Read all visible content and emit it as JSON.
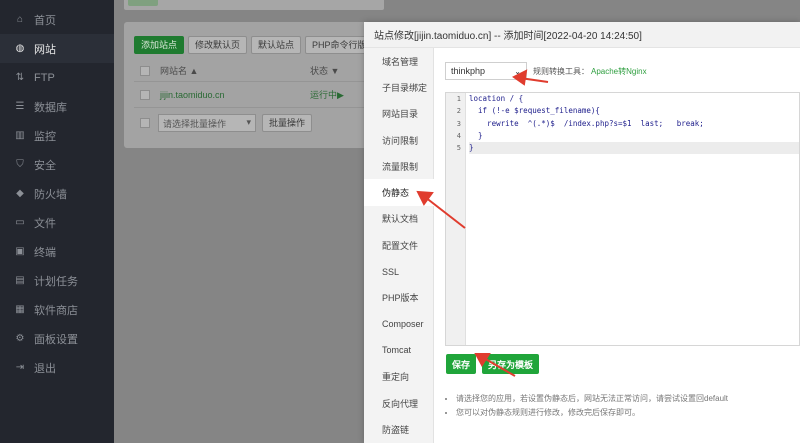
{
  "sidebar": {
    "items": [
      {
        "label": "首页",
        "icon": "home-icon",
        "glyph": "⌂",
        "active": false
      },
      {
        "label": "网站",
        "icon": "globe-icon",
        "glyph": "◍",
        "active": true
      },
      {
        "label": "FTP",
        "icon": "ftp-icon",
        "glyph": "⇅",
        "active": false
      },
      {
        "label": "数据库",
        "icon": "database-icon",
        "glyph": "☰",
        "active": false
      },
      {
        "label": "监控",
        "icon": "monitor-icon",
        "glyph": "▥",
        "active": false
      },
      {
        "label": "安全",
        "icon": "shield-icon",
        "glyph": "⛉",
        "active": false
      },
      {
        "label": "防火墙",
        "icon": "firewall-icon",
        "glyph": "◆",
        "active": false
      },
      {
        "label": "文件",
        "icon": "folder-icon",
        "glyph": "▭",
        "active": false
      },
      {
        "label": "终端",
        "icon": "terminal-icon",
        "glyph": "▣",
        "active": false
      },
      {
        "label": "计划任务",
        "icon": "calendar-icon",
        "glyph": "▤",
        "active": false
      },
      {
        "label": "软件商店",
        "icon": "apps-icon",
        "glyph": "▦",
        "active": false
      },
      {
        "label": "面板设置",
        "icon": "gear-icon",
        "glyph": "⚙",
        "active": false
      },
      {
        "label": "退出",
        "icon": "logout-icon",
        "glyph": "⇥",
        "active": false
      }
    ]
  },
  "main": {
    "buttons": [
      "添加站点",
      "修改默认页",
      "默认站点",
      "PHP命令行版本"
    ],
    "table": {
      "headers": {
        "name": "网站名 ▲",
        "status": "状态 ▼"
      },
      "rows": [
        {
          "name": "jijin.taomiduo.cn",
          "status": "运行中▶"
        }
      ]
    },
    "bulk": {
      "placeholder": "请选择批量操作",
      "button": "批量操作"
    }
  },
  "modal": {
    "title": "站点修改[jijin.taomiduo.cn] -- 添加时间[2022-04-20 14:24:50]",
    "tabs": [
      "域名管理",
      "子目录绑定",
      "网站目录",
      "访问限制",
      "流量限制",
      "伪静态",
      "默认文档",
      "配置文件",
      "SSL",
      "PHP版本",
      "Composer",
      "Tomcat",
      "重定向",
      "反向代理",
      "防盗链"
    ],
    "active_tab": "伪静态",
    "rewrite_select": "thinkphp",
    "rule_label": "规则转换工具：",
    "rule_link": "Apache转Nginx",
    "code_lines": [
      "location / {",
      "  if (!-e $request_filename){",
      "    rewrite  ^(.*)$  /index.php?s=$1  last;   break;",
      "  }",
      "}"
    ],
    "line_numbers": [
      "1",
      "2",
      "3",
      "4",
      "5"
    ],
    "save_label": "保存",
    "save_as_template_label": "另存为模板",
    "tips": [
      "请选择您的应用，若设置伪静态后，网站无法正常访问，请尝试设置回default",
      "您可以对伪静态规则进行修改，修改完后保存即可。"
    ]
  },
  "colors": {
    "accent": "#20a53a",
    "arrow": "#e03c2e",
    "sidebar_bg": "#23262e"
  }
}
